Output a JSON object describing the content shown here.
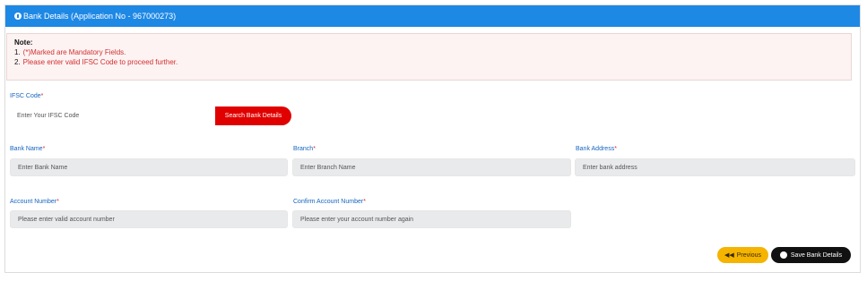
{
  "header": {
    "title": "Bank Details (Application No - 967000273)"
  },
  "note": {
    "title": "Note:",
    "items": [
      {
        "num": "1.",
        "text": "(*)Marked are Mandatory Fields."
      },
      {
        "num": "2.",
        "text": "Please enter valid IFSC Code to proceed further."
      }
    ]
  },
  "form": {
    "ifsc": {
      "label": "IFSC Code",
      "required": "*",
      "placeholder": "Enter Your IFSC Code"
    },
    "search_button": "Search Bank Details",
    "bank_name": {
      "label": "Bank Name",
      "required": "*",
      "placeholder": "Enter Bank Name"
    },
    "branch": {
      "label": "Branch",
      "required": "*",
      "placeholder": "Enter Branch Name"
    },
    "bank_address": {
      "label": "Bank Address",
      "required": "*",
      "placeholder": "Enter bank address"
    },
    "account_number": {
      "label": "Account Number",
      "required": "*",
      "placeholder": "Please enter valid account number"
    },
    "confirm_account_number": {
      "label": "Confirm Account Number",
      "required": "*",
      "placeholder": "Please enter your account number again"
    }
  },
  "actions": {
    "previous": "Previous",
    "save": "Save Bank Details"
  },
  "colors": {
    "header_bg": "#1e88e5",
    "search_button_bg": "#e00000",
    "previous_bg": "#f5b400",
    "save_bg": "#111111",
    "label": "#1565c0",
    "required": "#d32f2f"
  },
  "icons": {
    "header": "info-icon",
    "previous": "double-left-arrow-icon",
    "save": "circle-check-icon"
  }
}
